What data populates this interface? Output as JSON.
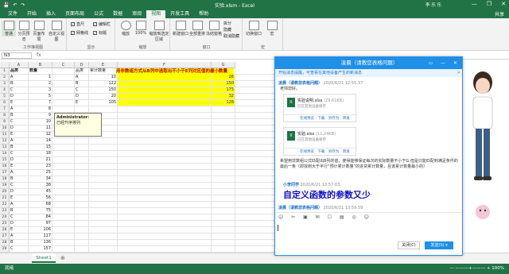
{
  "titlebar": {
    "qa": [
      "💾",
      "↶",
      "↷"
    ],
    "title": "实验.xlsm - Excel",
    "user": "李 乐 乐",
    "win": [
      "—",
      "❐",
      "✕"
    ]
  },
  "menu": {
    "tabs": [
      "文件",
      "开始",
      "插入",
      "页面布局",
      "公式",
      "数据",
      "审阅",
      "视图",
      "开发工具",
      "帮助"
    ],
    "active": 7,
    "share": "共享"
  },
  "ribbon": {
    "groups": [
      {
        "label": "工作簿视图",
        "buttons": [
          "普通",
          "分页预览",
          "页面布局",
          "自定义视图"
        ]
      },
      {
        "label": "显示",
        "checks": [
          {
            "t": "直尺",
            "on": true
          },
          {
            "t": "编辑栏",
            "on": true
          },
          {
            "t": "网格线",
            "on": true
          },
          {
            "t": "标题",
            "on": true
          }
        ]
      },
      {
        "label": "缩放",
        "buttons": [
          "缩放",
          "100%",
          "缩放到选定区域"
        ]
      },
      {
        "label": "窗口",
        "buttons": [
          "新建窗口",
          "全部重排",
          "冻结窗格"
        ],
        "small": [
          "拆分",
          "隐藏",
          "取消隐藏"
        ]
      },
      {
        "label": "宏",
        "buttons": [
          "切换窗口",
          "宏"
        ]
      }
    ]
  },
  "formula": {
    "namebox": "N3",
    "fx": "fx"
  },
  "grid": {
    "columns": [
      "A",
      "B",
      "C",
      "D",
      "E",
      "F",
      "G"
    ],
    "rows": [
      "1",
      "2",
      "3",
      "4",
      "5",
      "6",
      "7",
      "8",
      "9",
      "10",
      "11",
      "12",
      "13",
      "14",
      "15",
      "16",
      "17",
      "18",
      "19",
      "20",
      "21",
      "22",
      "23",
      "24",
      "25",
      "26",
      "27",
      "28",
      "29",
      "30"
    ],
    "ab_header": [
      "品类",
      "数量"
    ],
    "ab": [
      [
        "A",
        "1"
      ],
      [
        "B",
        "2"
      ],
      [
        "C",
        "3"
      ],
      [
        "D",
        "5"
      ],
      [
        "E",
        "7"
      ],
      [
        "A",
        "8"
      ],
      [
        "B",
        "9"
      ],
      [
        "C",
        "10"
      ],
      [
        "D",
        "11"
      ],
      [
        "E",
        "12"
      ],
      [
        "A",
        "14"
      ],
      [
        "B",
        "15"
      ],
      [
        "C",
        "18"
      ],
      [
        "D",
        "21"
      ],
      [
        "E",
        "23"
      ],
      [
        "A",
        "25"
      ],
      [
        "B",
        "34"
      ],
      [
        "C",
        "38"
      ],
      [
        "D",
        "45"
      ],
      [
        "E",
        "56"
      ],
      [
        "A",
        "68"
      ],
      [
        "B",
        "75"
      ],
      [
        "C",
        "84"
      ],
      [
        "D",
        "97"
      ],
      [
        "E",
        "106"
      ],
      [
        "A",
        "117"
      ],
      [
        "B",
        "136"
      ],
      [
        "C",
        "157"
      ],
      [
        "D",
        "568"
      ],
      [
        "E",
        "895"
      ]
    ],
    "de_header": [
      "品类",
      "累计数量"
    ],
    "de": [
      [
        "A",
        "10"
      ],
      [
        "B",
        "122"
      ],
      [
        "C",
        "150"
      ],
      [
        "D",
        "20"
      ],
      [
        "E",
        "105"
      ]
    ],
    "banner": "用非数组方式从B列中选取出不小于E列对应值的最小数量",
    "g": [
      "26",
      "150",
      "175",
      "32",
      "128"
    ],
    "comment": {
      "author": "Administrator:",
      "text": "已经升序排列"
    }
  },
  "sheet": {
    "tab": "Sheet1",
    "add": "⊕"
  },
  "status": {
    "text": "就绪",
    "zoom": "—  ———+———  +  100%"
  },
  "chat": {
    "title": "凌晨（请教您表格问题）",
    "controls": "▭ — ✕",
    "tip": "开始消息提醒，可查看在其他设备产生的新消息",
    "messages": [
      {
        "who": "凌晨（请教您表格问题）",
        "time": "2020/6/21 12:55:37"
      },
      {
        "text": "老师您好。"
      },
      {
        "file": "实验说明.xlsx",
        "size": "(29.61KB)",
        "ok": "已在其他设备保存",
        "acts": "在线预览  下载  另存为  转发"
      },
      {
        "file": "实验.xlsx",
        "size": "(11.24KB)",
        "ok": "已在其他设备保存",
        "acts": "在线预览  下载  另存为  转发"
      },
      {
        "text": "希望用非数组公式匹配出B列的值，使得能够保证每次的实际数量不小于G.但是只能匹配到满足条件的最后一条（即找到大于半行“预计累计数量”的进货累计数量，且该累计数量最小的）"
      },
      {
        "who": "小李同学",
        "time": "2020/6/21 13:57:03"
      },
      {
        "big": "自定义函数的参数又少"
      },
      {
        "who": "凌晨（请教您表格问题）",
        "time": "2020/6/21 13:59:59"
      }
    ],
    "toolbar": "☺ ✂ ▣ ✉ ☐ ▤ ◎ ☺",
    "close": "关闭(C)",
    "send": "发送(S) ▾"
  }
}
